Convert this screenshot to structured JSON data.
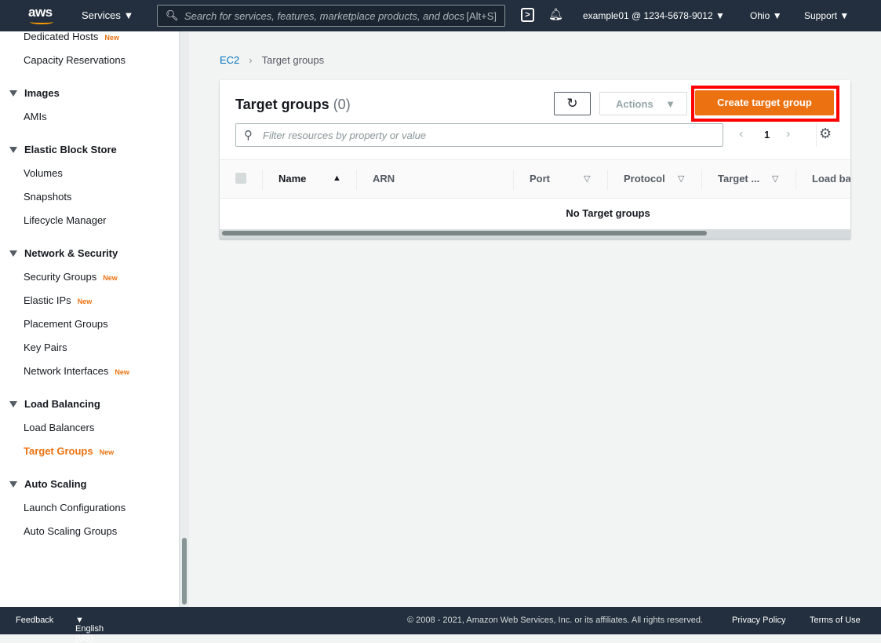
{
  "header": {
    "logo": "aws",
    "services": "Services",
    "search_placeholder": "Search for services, features, marketplace products, and docs",
    "search_hint": "[Alt+S]",
    "account": "example01 @ 1234-5678-9012",
    "region": "Ohio",
    "support": "Support"
  },
  "sidebar": [
    {
      "type": "item",
      "label": "Dedicated Hosts",
      "new": "New"
    },
    {
      "type": "item",
      "label": "Capacity Reservations"
    },
    {
      "type": "section",
      "label": "Images"
    },
    {
      "type": "item",
      "label": "AMIs"
    },
    {
      "type": "section",
      "label": "Elastic Block Store"
    },
    {
      "type": "item",
      "label": "Volumes"
    },
    {
      "type": "item",
      "label": "Snapshots"
    },
    {
      "type": "item",
      "label": "Lifecycle Manager"
    },
    {
      "type": "section",
      "label": "Network & Security"
    },
    {
      "type": "item",
      "label": "Security Groups",
      "new": "New"
    },
    {
      "type": "item",
      "label": "Elastic IPs",
      "new": "New"
    },
    {
      "type": "item",
      "label": "Placement Groups"
    },
    {
      "type": "item",
      "label": "Key Pairs"
    },
    {
      "type": "item",
      "label": "Network Interfaces",
      "new": "New"
    },
    {
      "type": "section",
      "label": "Load Balancing"
    },
    {
      "type": "item",
      "label": "Load Balancers"
    },
    {
      "type": "item",
      "label": "Target Groups",
      "new": "New",
      "active": true
    },
    {
      "type": "section",
      "label": "Auto Scaling"
    },
    {
      "type": "item",
      "label": "Launch Configurations"
    },
    {
      "type": "item",
      "label": "Auto Scaling Groups"
    }
  ],
  "breadcrumb": {
    "root": "EC2",
    "current": "Target groups"
  },
  "panel": {
    "title": "Target groups",
    "count": "(0)",
    "actions": "Actions",
    "create": "Create target group",
    "filter_placeholder": "Filter resources by property or value",
    "page": "1",
    "empty": "No Target groups",
    "columns": [
      "Name",
      "ARN",
      "Port",
      "Protocol",
      "Target ...",
      "Load ba"
    ]
  },
  "footer": {
    "feedback": "Feedback",
    "language": "English (US)",
    "copyright": "© 2008 - 2021, Amazon Web Services, Inc. or its affiliates. All rights reserved.",
    "privacy": "Privacy Policy",
    "terms": "Terms of Use"
  },
  "colors": {
    "accent": "#ec7211",
    "header": "#232f3e",
    "highlight": "#ff0000"
  }
}
